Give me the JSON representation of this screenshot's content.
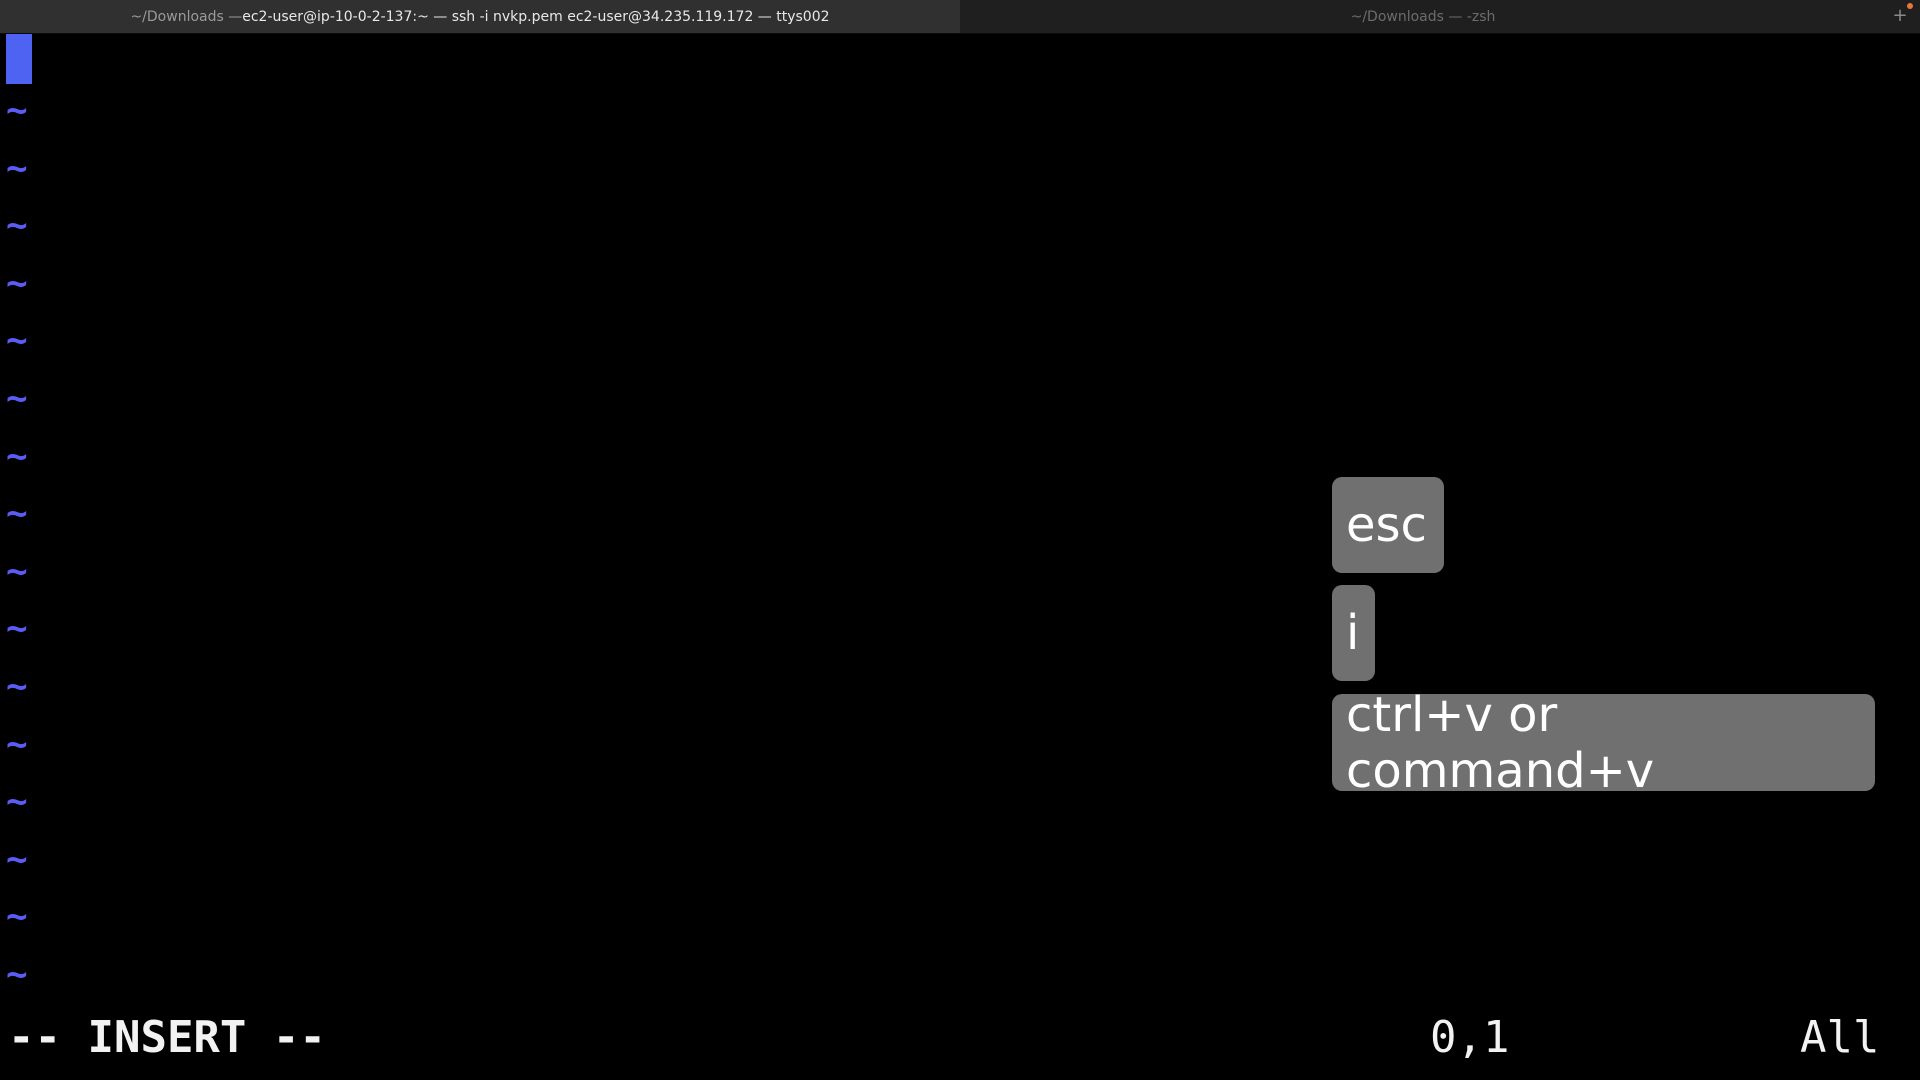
{
  "window": {
    "tabs": [
      {
        "label_dim": "~/Downloads — ",
        "label_main": "ec2-user@ip-10-0-2-137:~ — ssh -i nvkp.pem ec2-user@34.235.119.172 — ttys002",
        "active": true
      },
      {
        "label": "~/Downloads — -zsh",
        "active": false
      }
    ],
    "new_tab_label": "+",
    "new_tab_icon": "plus-icon"
  },
  "editor": {
    "empty_line_marker": "~",
    "cursor_color": "#4f63f2",
    "tilde_color": "#5a5cf5",
    "tildes": [
      "~",
      "~",
      "~",
      "~",
      "~",
      "~",
      "~",
      "~",
      "~",
      "~",
      "~",
      "~",
      "~",
      "~",
      "~",
      "~"
    ]
  },
  "statusline": {
    "mode": "-- INSERT --",
    "position": "0,1",
    "scroll": "All"
  },
  "key_overlay": {
    "keys": [
      "esc",
      "i",
      "ctrl+v or command+v"
    ],
    "keycap_color": "#707070"
  }
}
